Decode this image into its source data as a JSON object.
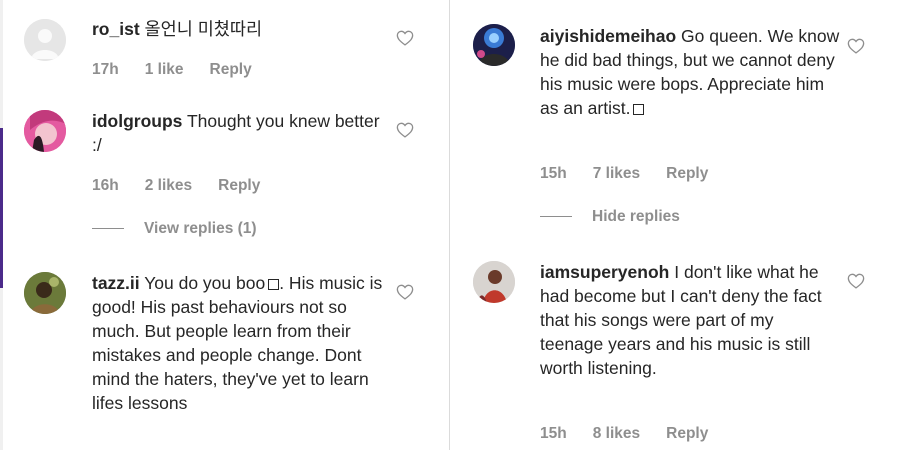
{
  "left_column": {
    "comments": [
      {
        "username": "ro_ist",
        "text": "올언니 미쳤따리",
        "time": "17h",
        "likes": "1 like",
        "reply": "Reply"
      },
      {
        "username": "idolgroups",
        "text": "Thought you knew better :/",
        "time": "16h",
        "likes": "2 likes",
        "reply": "Reply",
        "view_replies": "View replies (1)"
      },
      {
        "username": "tazz.ii",
        "text_part1": "You do you boo",
        "text_part2": ". His music is good! His past behaviours not so much. But people learn from their mistakes and people change. Dont mind the haters, they've yet to learn lifes lessons"
      }
    ]
  },
  "right_column": {
    "comments": [
      {
        "username": "aiyishidemeihao",
        "text": "Go queen. We know he did bad things, but we cannot deny his music were bops. Appreciate him as an artist.",
        "time": "15h",
        "likes": "7 likes",
        "reply": "Reply",
        "hide_replies": "Hide replies"
      },
      {
        "username": "iamsuperyenoh",
        "text": "I don't like what he had become but I can't deny the fact that his songs were part of my teenage years and his music is still worth listening.",
        "time": "15h",
        "likes": "8 likes",
        "reply": "Reply"
      }
    ]
  },
  "icons": {
    "like": "heart-outline-icon",
    "emoji_missing": "missing-glyph-box"
  },
  "colors": {
    "text": "#262626",
    "meta": "#8e8e8e",
    "divider": "#dbdbdb"
  }
}
